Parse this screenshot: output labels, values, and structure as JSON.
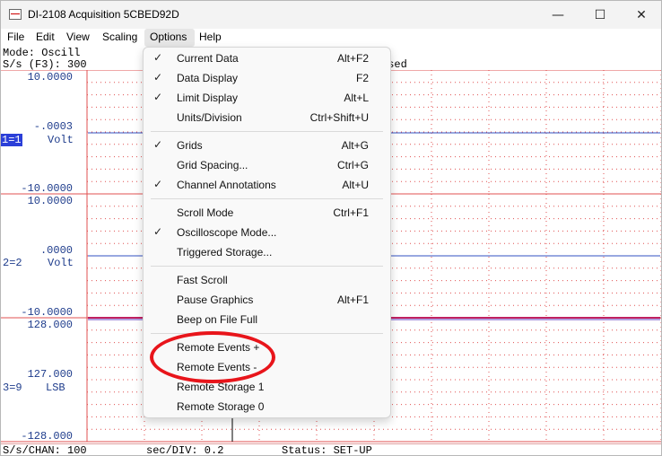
{
  "window": {
    "title": "DI-2108 Acquisition 5CBED92D",
    "controls": {
      "minimize": "—",
      "maximize": "☐",
      "close": "✕"
    }
  },
  "menubar": {
    "file": "File",
    "edit": "Edit",
    "view": "View",
    "scaling": "Scaling",
    "options": "Options",
    "help": "Help"
  },
  "status": {
    "mode": "Mode: Oscill",
    "rate": "S/s (F3): 300",
    "paused": "used"
  },
  "channels": [
    {
      "id": "1=1",
      "unit": "Volt",
      "top": "10.0000",
      "mid": "-.0003",
      "bottom": "-10.0000"
    },
    {
      "id": "2=2",
      "unit": "Volt",
      "top": "10.0000",
      "mid": ".0000",
      "bottom": "-10.0000"
    },
    {
      "id": "3=9",
      "unit": "LSB",
      "top": "128.000",
      "mid": "127.000",
      "bottom": "-128.000"
    }
  ],
  "bottom_status": {
    "chan": "S/s/CHAN: 100",
    "div": "sec/DIV: 0.2",
    "status": "Status: SET-UP"
  },
  "options_menu": {
    "items": [
      {
        "label": "Current Data",
        "shortcut": "Alt+F2",
        "checked": true
      },
      {
        "label": "Data Display",
        "shortcut": "F2",
        "checked": true
      },
      {
        "label": "Limit Display",
        "shortcut": "Alt+L",
        "checked": true
      },
      {
        "label": "Units/Division",
        "shortcut": "Ctrl+Shift+U",
        "checked": false
      },
      {
        "label": "Grids",
        "shortcut": "Alt+G",
        "checked": true
      },
      {
        "label": "Grid Spacing...",
        "shortcut": "Ctrl+G",
        "checked": false
      },
      {
        "label": "Channel Annotations",
        "shortcut": "Alt+U",
        "checked": true
      },
      {
        "label": "Scroll Mode",
        "shortcut": "Ctrl+F1",
        "checked": false
      },
      {
        "label": "Oscilloscope Mode...",
        "shortcut": "",
        "checked": true
      },
      {
        "label": "Triggered Storage...",
        "shortcut": "",
        "checked": false
      },
      {
        "label": "Fast Scroll",
        "shortcut": "",
        "checked": false
      },
      {
        "label": "Pause Graphics",
        "shortcut": "Alt+F1",
        "checked": false
      },
      {
        "label": "Beep on File Full",
        "shortcut": "",
        "checked": false
      },
      {
        "label": "Remote Events +",
        "shortcut": "",
        "checked": false
      },
      {
        "label": "Remote Events -",
        "shortcut": "",
        "checked": false
      },
      {
        "label": "Remote Storage 1",
        "shortcut": "",
        "checked": false
      },
      {
        "label": "Remote Storage 0",
        "shortcut": "",
        "checked": false
      }
    ],
    "check_glyph": "✓"
  },
  "colors": {
    "grid": "#e05050",
    "trace": "#3050c0",
    "annotation": "#e8151b",
    "channel_highlight": "#2b3fd8"
  }
}
